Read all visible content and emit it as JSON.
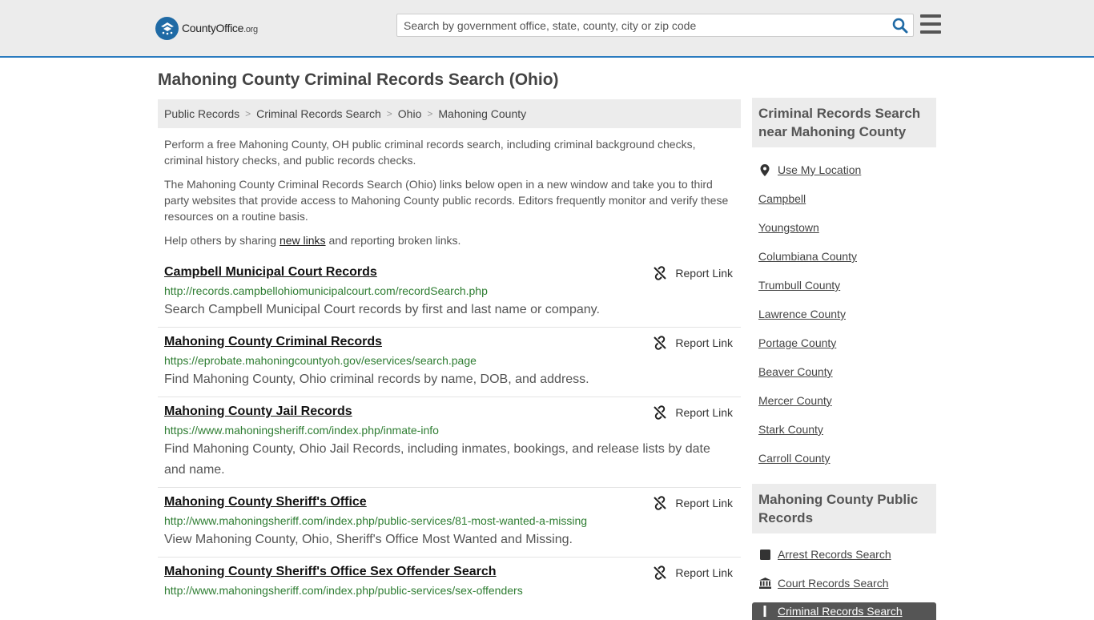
{
  "header": {
    "logo_main": "CountyOffice",
    "logo_tld": ".org",
    "search_placeholder": "Search by government office, state, county, city or zip code"
  },
  "page_title": "Mahoning County Criminal Records Search (Ohio)",
  "breadcrumb": [
    "Public Records",
    "Criminal Records Search",
    "Ohio",
    "Mahoning County"
  ],
  "intro": {
    "p1": "Perform a free Mahoning County, OH public criminal records search, including criminal background checks, criminal history checks, and public records checks.",
    "p2": "The Mahoning County Criminal Records Search (Ohio) links below open in a new window and take you to third party websites that provide access to Mahoning County public records. Editors frequently monitor and verify these resources on a routine basis.",
    "p3_before": "Help others by sharing ",
    "p3_link": "new links",
    "p3_after": " and reporting broken links."
  },
  "report_label": "Report Link",
  "links": [
    {
      "title": "Campbell Municipal Court Records",
      "url": "http://records.campbellohiomunicipalcourt.com/recordSearch.php",
      "desc": "Search Campbell Municipal Court records by first and last name or company."
    },
    {
      "title": "Mahoning County Criminal Records",
      "url": "https://eprobate.mahoningcountyoh.gov/eservices/search.page",
      "desc": "Find Mahoning County, Ohio criminal records by name, DOB, and address."
    },
    {
      "title": "Mahoning County Jail Records",
      "url": "https://www.mahoningsheriff.com/index.php/inmate-info",
      "desc": "Find Mahoning County, Ohio Jail Records, including inmates, bookings, and release lists by date and name."
    },
    {
      "title": "Mahoning County Sheriff's Office",
      "url": "http://www.mahoningsheriff.com/index.php/public-services/81-most-wanted-a-missing",
      "desc": "View Mahoning County, Ohio, Sheriff's Office Most Wanted and Missing."
    },
    {
      "title": "Mahoning County Sheriff's Office Sex Offender Search",
      "url": "http://www.mahoningsheriff.com/index.php/public-services/sex-offenders",
      "desc": ""
    }
  ],
  "sidebar": {
    "nearby_title": "Criminal Records Search near Mahoning County",
    "use_location": "Use My Location",
    "nearby": [
      "Campbell",
      "Youngstown",
      "Columbiana County",
      "Trumbull County",
      "Lawrence County",
      "Portage County",
      "Beaver County",
      "Mercer County",
      "Stark County",
      "Carroll County"
    ],
    "public_title": "Mahoning County Public Records",
    "public_records": [
      {
        "label": "Arrest Records Search",
        "icon": "square-icon"
      },
      {
        "label": "Court Records Search",
        "icon": "courthouse-icon"
      }
    ],
    "active_item": "Criminal Records Search"
  },
  "colors": {
    "accent": "#2a7bbf",
    "url_green": "#2e7d32",
    "header_bg": "#ececec"
  }
}
